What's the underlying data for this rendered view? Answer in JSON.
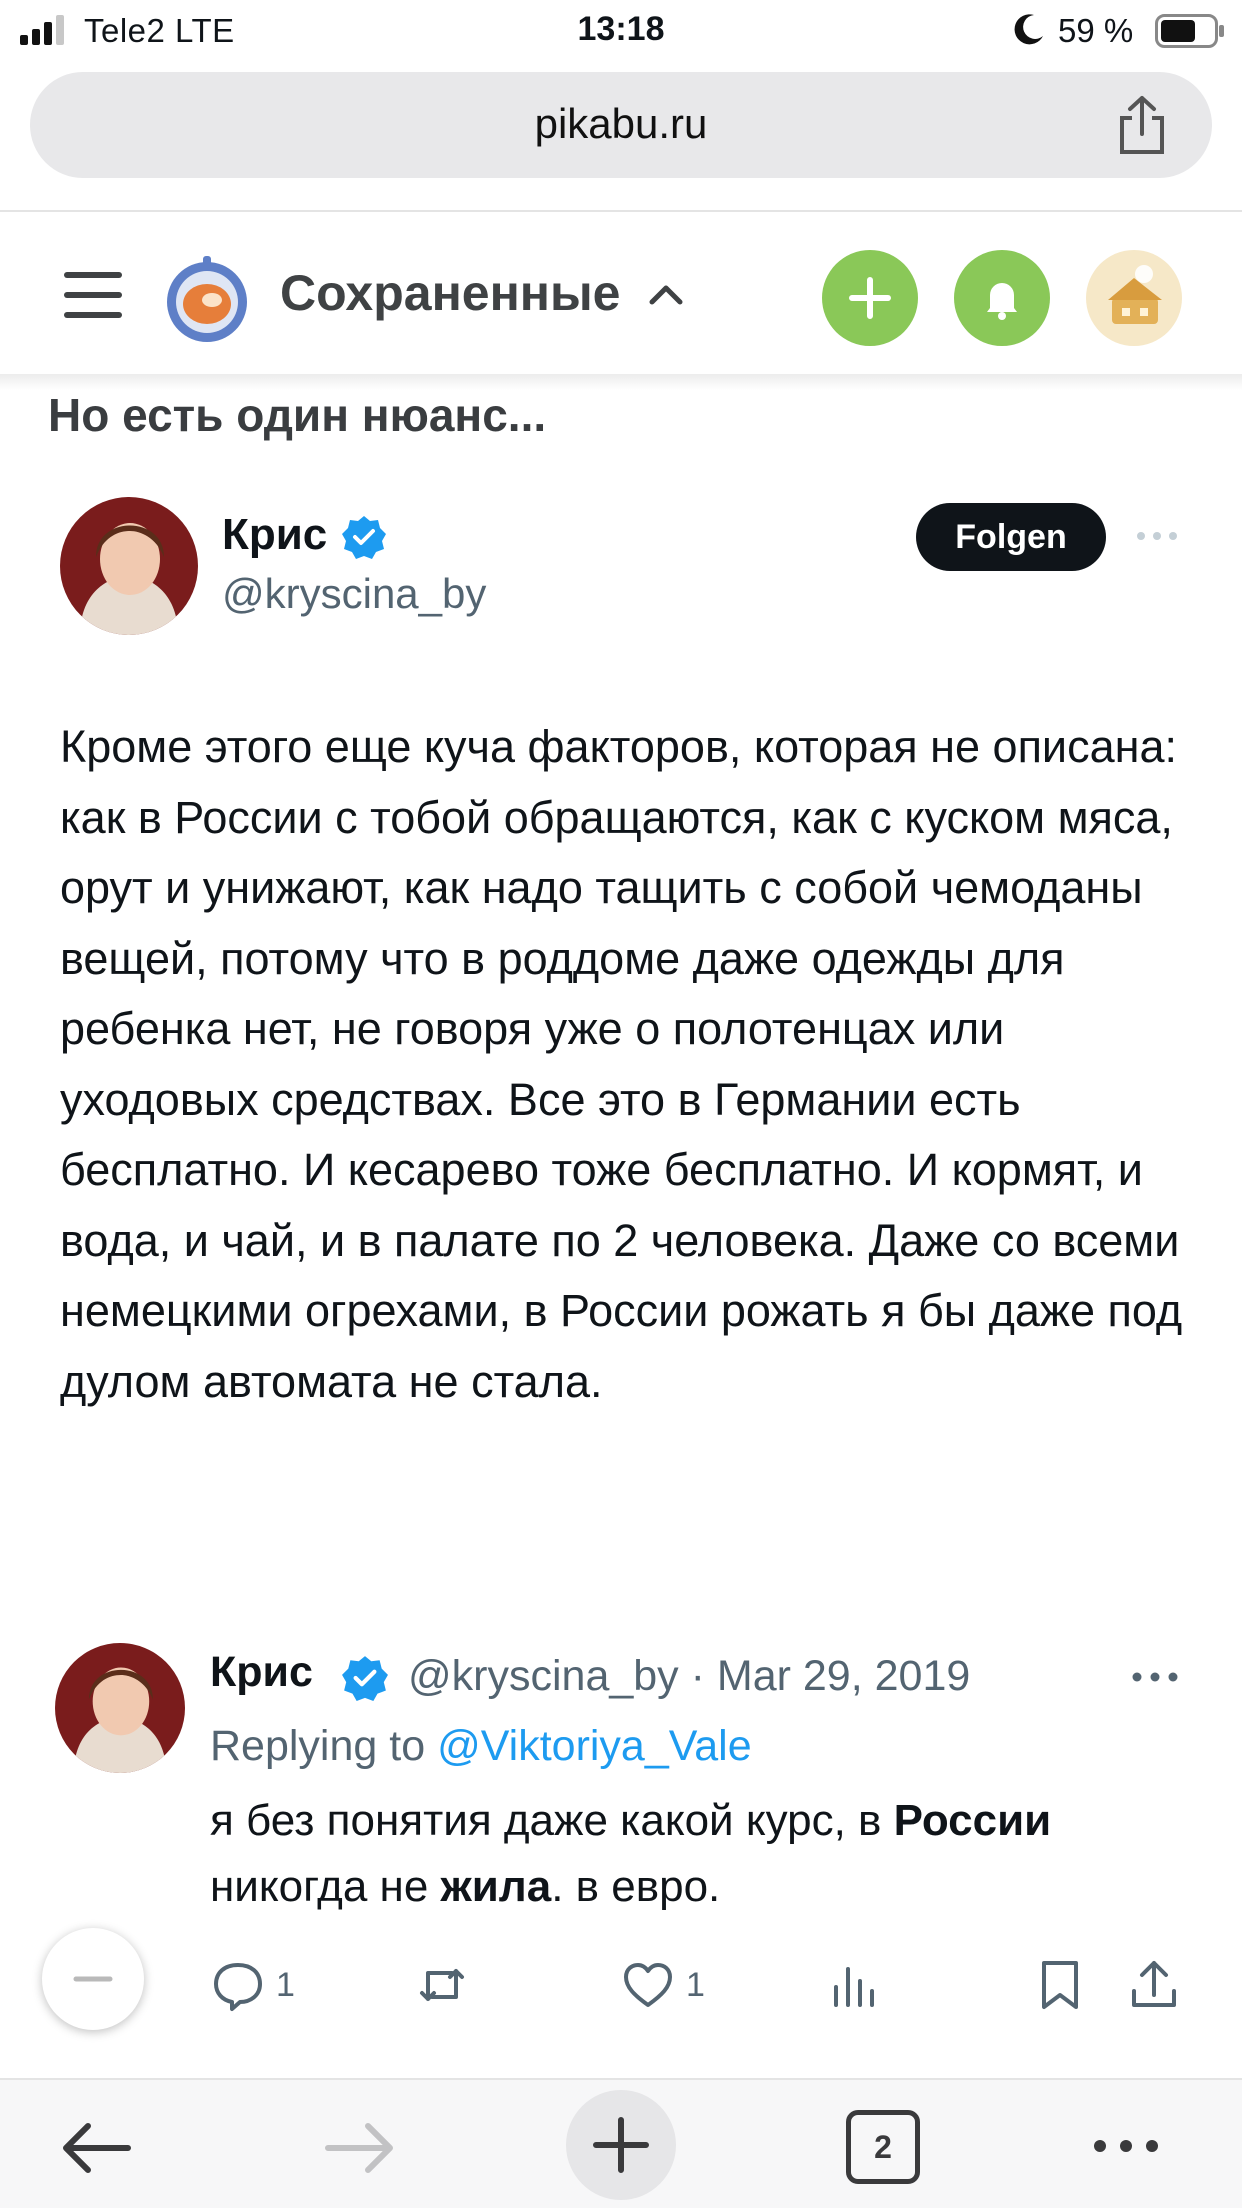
{
  "status_bar": {
    "carrier": "Tele2  LTE",
    "time": "13:18",
    "battery_percent": "59 %"
  },
  "browser": {
    "url": "pikabu.ru",
    "tabs_count": "2"
  },
  "app_header": {
    "title": "Сохраненные"
  },
  "post": {
    "title": "Но есть один нюанс..."
  },
  "tweet": {
    "name": "Крис",
    "handle": "@kryscina_by",
    "follow_label": "Folgen",
    "body": "Кроме этого еще куча факторов, которая не описана: как в России с тобой обращаются, как с куском мяса, орут и унижают, как надо тащить с собой чемоданы вещей, потому что в роддоме даже одежды для ребенка нет, не говоря уже о полотенцах или уходовых средствах. Все это в Германии есть бесплатно. И кесарево тоже бесплатно. И кормят, и вода, и чай, и в палате по 2 человека. Даже со всеми немецкими огрехами, в России рожать я бы даже под дулом автомата не стала."
  },
  "reply": {
    "name": "Крис",
    "handle_date": "@kryscina_by · Mar 29, 2019",
    "replying_prefix": "Replying to",
    "replying_to": "@Viktoriya_Vale",
    "body_part1": "я без понятия даже какой курс, в ",
    "body_bold1": "России",
    "body_part2": " никогда не ",
    "body_bold2": "жила",
    "body_part3": ". в евро.",
    "reply_count": "1",
    "like_count": "1"
  },
  "colors": {
    "green_button": "#8ac858",
    "verified_blue": "#1d9bf0",
    "muted_text": "#536471"
  },
  "icons": [
    "signal-icon",
    "moon-icon",
    "battery-icon",
    "share-icon",
    "menu-icon",
    "pikabu-logo",
    "caret-up-icon",
    "plus-icon",
    "bell-icon",
    "verified-icon",
    "more-icon",
    "reply-icon",
    "retweet-icon",
    "like-icon",
    "views-icon",
    "bookmark-icon",
    "minus-icon",
    "back-arrow-icon",
    "forward-arrow-icon"
  ]
}
